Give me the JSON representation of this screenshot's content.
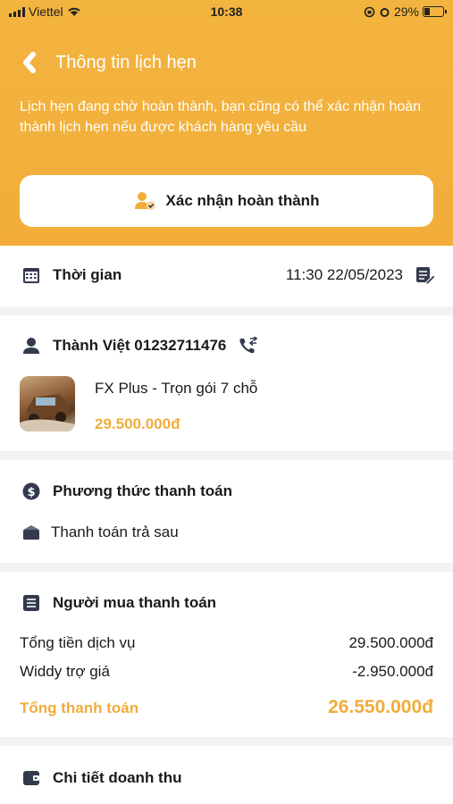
{
  "status_bar": {
    "carrier": "Viettel",
    "time": "10:38",
    "battery": "29%",
    "battery_level": 0.29
  },
  "header": {
    "title": "Thông tin lịch hẹn",
    "description": "Lịch hẹn đang chờ hoàn thành, bạn cũng có thể xác nhận hoàn thành lịch hẹn nếu được khách hàng yêu cầu",
    "confirm_label": "Xác nhận hoàn thành"
  },
  "time_section": {
    "label": "Thời gian",
    "value": "11:30 22/05/2023"
  },
  "customer": {
    "name_phone": "Thành Việt 01232711476"
  },
  "service": {
    "name": "FX Plus - Trọn gói 7 chỗ",
    "price": "29.500.000đ"
  },
  "payment_method": {
    "title": "Phương thức thanh toán",
    "method": "Thanh toán trả sau"
  },
  "buyer_payment": {
    "title": "Người mua thanh toán",
    "rows": [
      {
        "label": "Tổng tiền dịch vụ",
        "value": "29.500.000đ"
      },
      {
        "label": "Widdy trợ giá",
        "value": "-2.950.000đ"
      }
    ],
    "total_label": "Tổng thanh toán",
    "total_value": "26.550.000đ"
  },
  "revenue": {
    "title": "Chi tiết doanh thu"
  },
  "colors": {
    "accent": "#f2ad3a",
    "background": "#f2f2f4",
    "icon": "#333a4d"
  }
}
